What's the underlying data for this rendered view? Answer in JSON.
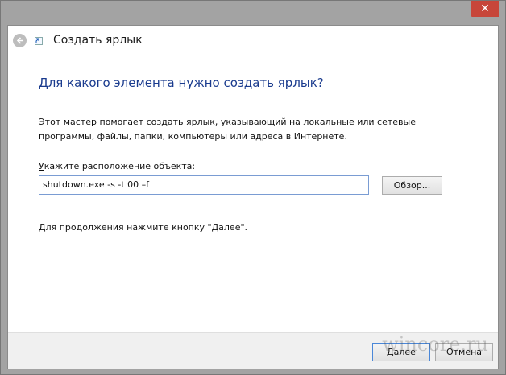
{
  "window": {
    "close_label": "✕"
  },
  "header": {
    "title": "Создать ярлык"
  },
  "main": {
    "heading": "Для какого элемента нужно создать ярлык?",
    "description": "Этот мастер помогает создать ярлык, указывающий на локальные или сетевые программы, файлы, папки, компьютеры или адреса в Интернете.",
    "location_label_first": "У",
    "location_label_rest": "кажите расположение объекта:",
    "location_value": "shutdown.exe -s -t 00 –f",
    "browse_button": "Обзор...",
    "hint": "Для продолжения нажмите кнопку \"Далее\"."
  },
  "footer": {
    "next_button": "Далее",
    "cancel_button": "Отмена"
  },
  "watermark": "wincore.ru",
  "colors": {
    "heading": "#1a3b8e",
    "close": "#c7463a",
    "input_border": "#7a9cd3"
  }
}
